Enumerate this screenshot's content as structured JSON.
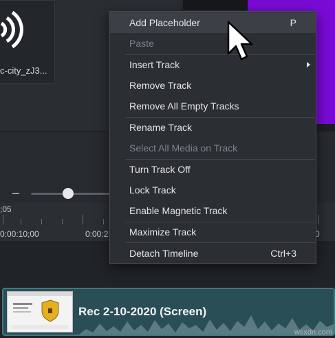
{
  "media_bin": {
    "item_name": "c-city_zJ3...",
    "item_icon": "audio-wave-icon"
  },
  "canvas": {
    "background_color": "#7a0bd6"
  },
  "zoom": {
    "minus_label": "–",
    "level": 0.45
  },
  "ruler": {
    "labels": [
      ";05",
      "0:00:10;00",
      "0:00:2",
      "0"
    ]
  },
  "context_menu": {
    "items": [
      {
        "label": "Add Placeholder",
        "shortcut": "P",
        "disabled": false
      },
      {
        "label": "Paste",
        "disabled": true
      },
      {
        "label": "Insert Track",
        "has_submenu": true,
        "disabled": false
      },
      {
        "label": "Remove Track",
        "disabled": false
      },
      {
        "label": "Remove All Empty Tracks",
        "disabled": false
      },
      {
        "label": "Rename Track",
        "disabled": false
      },
      {
        "label": "Select All Media on Track",
        "disabled": true
      },
      {
        "label": "Turn Track Off",
        "disabled": false
      },
      {
        "label": "Lock Track",
        "disabled": false
      },
      {
        "label": "Enable Magnetic Track",
        "disabled": false
      },
      {
        "label": "Maximize Track",
        "disabled": false
      },
      {
        "label": "Detach Timeline",
        "shortcut": "Ctrl+3",
        "disabled": false
      }
    ]
  },
  "timeline": {
    "clip_label": "Rec 2-10-2020 (Screen)"
  },
  "watermark": "wsxdn.com",
  "colors": {
    "clip_bg": "#2a4e55",
    "menu_bg": "#2b2e33"
  }
}
